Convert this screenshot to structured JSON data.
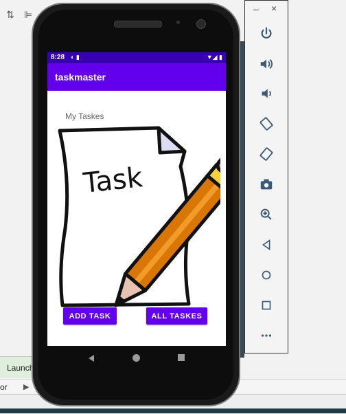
{
  "ide": {
    "launch_label": "Launch",
    "bottom_text": "or"
  },
  "emulator_panel": {
    "minimize_symbol": "–",
    "close_symbol": "×",
    "buttons": [
      "power-icon",
      "volume-up-icon",
      "volume-down-icon",
      "rotate-left-icon",
      "rotate-right-icon",
      "camera-icon",
      "zoom-in-icon",
      "back-icon",
      "home-icon",
      "overview-icon",
      "more-icon"
    ]
  },
  "status_bar": {
    "time": "8:28",
    "left_icons": "◐ ▮",
    "right_icons": "▼◢ ▮"
  },
  "app": {
    "title": "taskmaster",
    "heading": "My Taskes",
    "illustration_text": "Task",
    "add_task_label": "ADD TASK",
    "all_tasks_label": "ALL TASKES"
  },
  "colors": {
    "primary": "#6200ee",
    "primary_dark": "#3700b3"
  }
}
